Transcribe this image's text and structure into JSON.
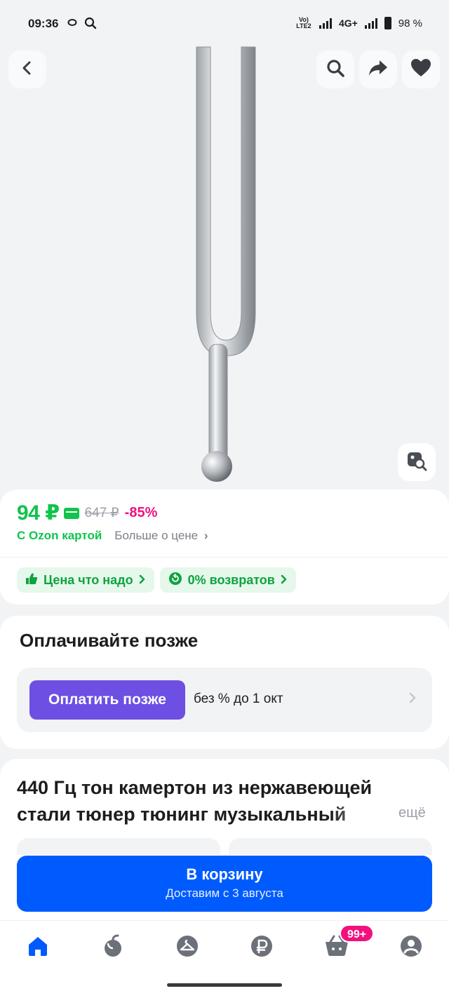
{
  "status_bar": {
    "time": "09:36",
    "network_label": "Vo) LTE2",
    "network_type": "4G+",
    "battery": "98 %"
  },
  "image_toolbar": {
    "back_icon": "chevron-left-icon",
    "search_icon": "search-icon",
    "share_icon": "share-icon",
    "favorite_icon": "heart-icon",
    "lens_icon": "image-search-icon"
  },
  "price": {
    "current": "94 ₽",
    "old": "647 ₽",
    "discount": "-85%",
    "ozon_card_label": "С Ozon картой",
    "more_about_price": "Больше о цене",
    "chevron": "›"
  },
  "chips": [
    {
      "label": "Цена что надо",
      "icon": "thumbs-up-icon"
    },
    {
      "label": "0% возвратов",
      "icon": "return-icon"
    }
  ],
  "pay_later": {
    "title": "Оплачивайте позже",
    "button_label": "Оплатить позже",
    "note": "без % до 1 окт"
  },
  "product": {
    "title": "440 Гц тон камертон из нержавеющей стали тюнер тюнинг музыкальный",
    "more": "ещё"
  },
  "cart": {
    "label": "В корзину",
    "delivery": "Доставим с 3 августа"
  },
  "bottom_nav": {
    "items": [
      "home-icon",
      "catalog-icon",
      "fresh-icon",
      "finance-icon",
      "cart-icon",
      "profile-icon"
    ],
    "cart_badge": "99+"
  },
  "colors": {
    "accent": "#005bff",
    "price_green": "#10c44c",
    "discount_pink": "#f1117e",
    "pay_purple": "#6d4fe3"
  }
}
